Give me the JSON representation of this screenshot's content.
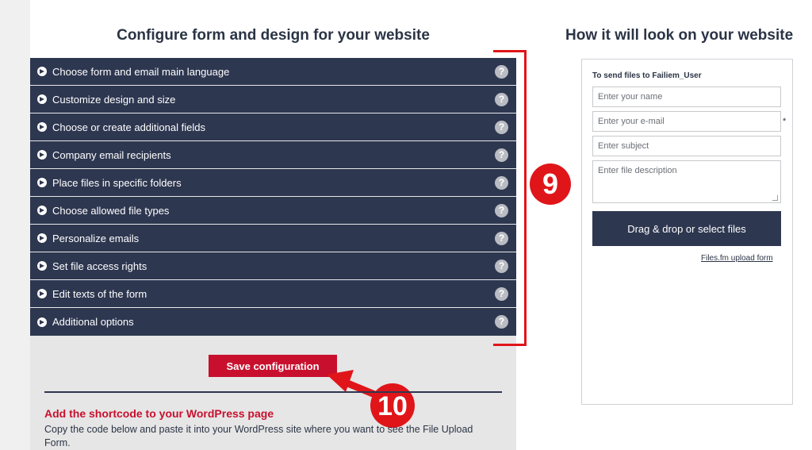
{
  "left_title": "Configure form and design for your website",
  "right_title": "How it will look on your website",
  "accordion": {
    "items": [
      {
        "label": "Choose form and email main language"
      },
      {
        "label": "Customize design and size"
      },
      {
        "label": "Choose or create additional fields"
      },
      {
        "label": "Company email recipients"
      },
      {
        "label": "Place files in specific folders"
      },
      {
        "label": "Choose allowed file types"
      },
      {
        "label": "Personalize emails"
      },
      {
        "label": "Set file access rights"
      },
      {
        "label": "Edit texts of the form"
      },
      {
        "label": "Additional options"
      }
    ],
    "help_symbol": "?"
  },
  "save_label": "Save configuration",
  "annotations": {
    "badge_a": "9",
    "badge_b": "10",
    "color": "#e0151a"
  },
  "shortcode": {
    "title": "Add the shortcode to your WordPress page",
    "description": "Copy the code below and paste it into your WordPress site where you want to see the File Upload Form."
  },
  "preview": {
    "send_to": "To send files to Failiem_User",
    "name_placeholder": "Enter your name",
    "email_placeholder": "Enter your e-mail",
    "required_mark": "*",
    "subject_placeholder": "Enter subject",
    "description_placeholder": "Enter file description",
    "drop_label": "Drag & drop or select files",
    "footer_link": "Files.fm upload form"
  },
  "colors": {
    "navy": "#2e3750",
    "red": "#c8102e",
    "annotation_red": "#e0151a"
  },
  "icons": [
    "arrow-right-circle-icon",
    "help-icon",
    "resize-handle-icon"
  ]
}
